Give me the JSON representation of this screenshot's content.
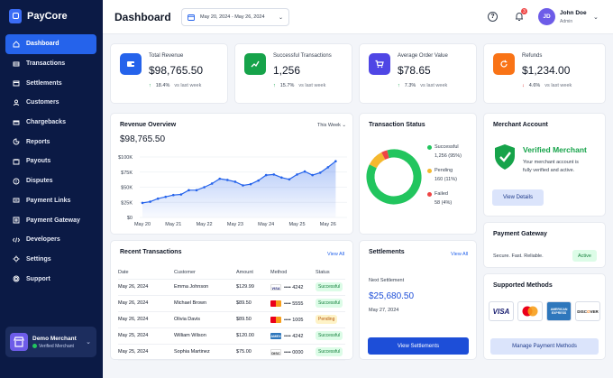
{
  "app": {
    "name": "PayCore"
  },
  "nav": [
    {
      "label": "Dashboard",
      "icon": "home-icon"
    },
    {
      "label": "Transactions",
      "icon": "transactions-icon"
    },
    {
      "label": "Settlements",
      "icon": "calendar-icon"
    },
    {
      "label": "Customers",
      "icon": "users-icon"
    },
    {
      "label": "Chargebacks",
      "icon": "card-icon"
    },
    {
      "label": "Reports",
      "icon": "reports-icon"
    },
    {
      "label": "Payouts",
      "icon": "payouts-icon"
    },
    {
      "label": "Disputes",
      "icon": "disputes-icon"
    },
    {
      "label": "Payment Links",
      "icon": "link-icon"
    },
    {
      "label": "Payment Gateway",
      "icon": "gateway-icon"
    },
    {
      "label": "Developers",
      "icon": "code-icon"
    },
    {
      "label": "Settings",
      "icon": "gear-icon"
    },
    {
      "label": "Support",
      "icon": "support-icon"
    }
  ],
  "merchant": {
    "name": "Demo Merchant",
    "status": "Verified Merchant"
  },
  "header": {
    "title": "Dashboard",
    "date_range": "May 20, 2024 - May 26, 2024",
    "notifications": "3",
    "user_initials": "JD",
    "user_name": "John Doe",
    "user_role": "Admin"
  },
  "stats": [
    {
      "label": "Total Revenue",
      "value": "$98,765.50",
      "change": "18.4%",
      "period": "vs last week",
      "direction": "up",
      "color": "#2563eb",
      "icon": "wallet-icon"
    },
    {
      "label": "Successful Transactions",
      "value": "1,256",
      "change": "15.7%",
      "period": "vs last week",
      "direction": "up",
      "color": "#16a34a",
      "icon": "trend-icon"
    },
    {
      "label": "Average Order Value",
      "value": "$78.65",
      "change": "7.3%",
      "period": "vs last week",
      "direction": "up",
      "color": "#4f46e5",
      "icon": "cart-icon"
    },
    {
      "label": "Refunds",
      "value": "$1,234.00",
      "change": "4.6%",
      "period": "vs last week",
      "direction": "down",
      "color": "#f97316",
      "icon": "refresh-icon"
    }
  ],
  "revenue": {
    "title": "Revenue Overview",
    "period": "This Week",
    "total": "$98,765.50"
  },
  "chart_data": {
    "type": "area",
    "x": [
      "May 20",
      "May 21",
      "May 22",
      "May 23",
      "May 24",
      "May 25",
      "May 26"
    ],
    "points": [
      {
        "x": 0,
        "y": 24000
      },
      {
        "x": 0.25,
        "y": 26000
      },
      {
        "x": 0.5,
        "y": 31000
      },
      {
        "x": 0.75,
        "y": 34000
      },
      {
        "x": 1,
        "y": 37000
      },
      {
        "x": 1.25,
        "y": 38000
      },
      {
        "x": 1.5,
        "y": 45000
      },
      {
        "x": 1.75,
        "y": 45000
      },
      {
        "x": 2,
        "y": 50000
      },
      {
        "x": 2.25,
        "y": 56000
      },
      {
        "x": 2.5,
        "y": 64000
      },
      {
        "x": 2.75,
        "y": 62000
      },
      {
        "x": 3,
        "y": 59000
      },
      {
        "x": 3.25,
        "y": 53000
      },
      {
        "x": 3.5,
        "y": 55000
      },
      {
        "x": 3.75,
        "y": 61000
      },
      {
        "x": 4,
        "y": 70000
      },
      {
        "x": 4.25,
        "y": 71000
      },
      {
        "x": 4.5,
        "y": 66000
      },
      {
        "x": 4.75,
        "y": 63000
      },
      {
        "x": 5,
        "y": 71000
      },
      {
        "x": 5.25,
        "y": 76000
      },
      {
        "x": 5.5,
        "y": 70000
      },
      {
        "x": 5.75,
        "y": 74000
      },
      {
        "x": 6,
        "y": 83000
      },
      {
        "x": 6.25,
        "y": 93000
      }
    ],
    "yticks": [
      "$0",
      "$25K",
      "$50K",
      "$75K",
      "$100K"
    ],
    "ylim": [
      0,
      100000
    ],
    "color": "#2563eb"
  },
  "status": {
    "title": "Transaction Status",
    "items": [
      {
        "label": "Successful",
        "value": "1,256 (95%)",
        "pct": 95,
        "color": "#22c55e"
      },
      {
        "label": "Pending",
        "value": "160 (11%)",
        "pct": 11,
        "color": "#f5b82e"
      },
      {
        "label": "Failed",
        "value": "58 (4%)",
        "pct": 4,
        "color": "#ef4444"
      }
    ]
  },
  "account": {
    "title": "Merchant Account",
    "heading": "Verified Merchant",
    "desc1": "Your merchant account is",
    "desc2": "fully verified and active.",
    "button": "View Details"
  },
  "gateway": {
    "title": "Payment Gateway",
    "text": "Secure. Fast. Reliable.",
    "badge": "Active"
  },
  "methods": {
    "title": "Supported Methods",
    "logos": [
      "VISA",
      "Mastercard",
      "AMERICAN EXPRESS",
      "DISCOVER"
    ],
    "button": "Manage Payment Methods"
  },
  "recent": {
    "title": "Recent Transactions",
    "link": "View All",
    "columns": [
      "Date",
      "Customer",
      "Amount",
      "Method",
      "Status"
    ],
    "rows": [
      {
        "date": "May 26, 2024",
        "customer": "Emma Johnson",
        "amount": "$129.99",
        "brand": "VISA",
        "last4": "•••• 4242",
        "status": "Successful"
      },
      {
        "date": "May 26, 2024",
        "customer": "Michael Brown",
        "amount": "$89.50",
        "brand": "MC",
        "last4": "•••• 5555",
        "status": "Successful"
      },
      {
        "date": "May 26, 2024",
        "customer": "Olivia Davis",
        "amount": "$89.50",
        "brand": "MC",
        "last4": "•••• 1005",
        "status": "Pending"
      },
      {
        "date": "May 25, 2024",
        "customer": "William Wilson",
        "amount": "$120.00",
        "brand": "AMEX",
        "last4": "•••• 4242",
        "status": "Successful"
      },
      {
        "date": "May 25, 2024",
        "customer": "Sophia Martinez",
        "amount": "$75.00",
        "brand": "DISC",
        "last4": "•••• 0000",
        "status": "Successful"
      }
    ]
  },
  "settlements": {
    "title": "Settlements",
    "link": "View All",
    "label": "Next Settlement",
    "amount": "$25,680.50",
    "date": "May 27, 2024",
    "button": "View Settlements"
  }
}
